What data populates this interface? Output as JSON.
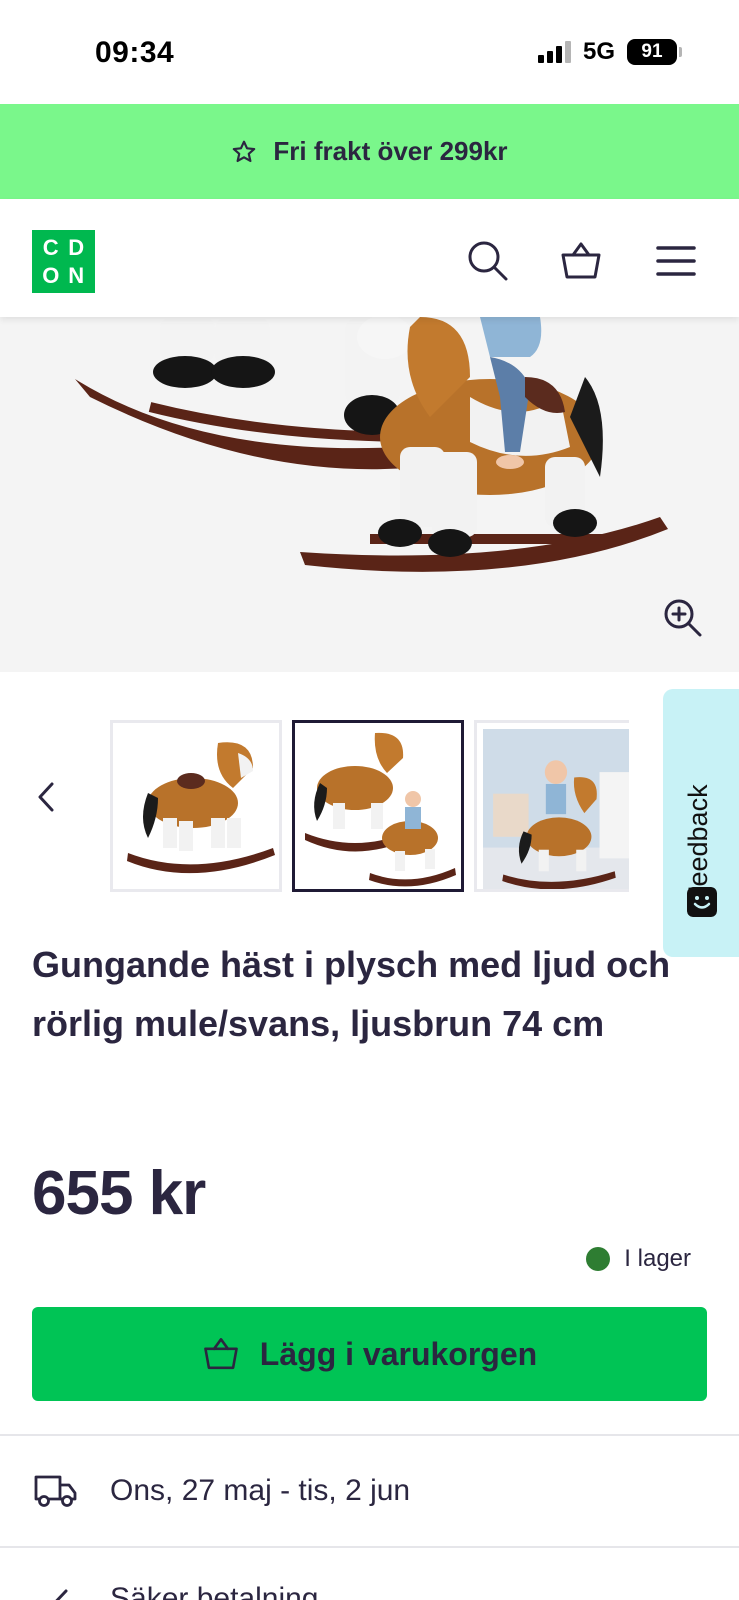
{
  "status_bar": {
    "time": "09:34",
    "network": "5G",
    "battery": "91"
  },
  "promo": {
    "icon": "star-icon",
    "text": "Fri frakt över 299kr"
  },
  "header": {
    "logo_letters": [
      "C",
      "D",
      "O",
      "N"
    ],
    "icons": [
      "search-icon",
      "cart-icon",
      "menu-icon"
    ]
  },
  "product": {
    "title": "Gungande häst i plysch med ljud och rörlig mule/svans, ljusbrun 74 cm",
    "price": "655 kr",
    "stock": {
      "label": "I lager",
      "color": "#2e7d32"
    }
  },
  "gallery": {
    "active_thumbnail": 2,
    "thumbnail_count": 3
  },
  "feedback": {
    "label": "Feedback"
  },
  "cart_button": {
    "label": "Lägg i varukorgen",
    "color": "#00c455"
  },
  "delivery": {
    "date_text": "Ons, 27 maj - tis, 2 jun",
    "next_row_text": "Säker betalning"
  },
  "colors": {
    "promo_bg": "#7af78b",
    "brand_green": "#00b84f",
    "text_dark": "#2b2640",
    "feedback_bg": "#c8f2f6"
  }
}
